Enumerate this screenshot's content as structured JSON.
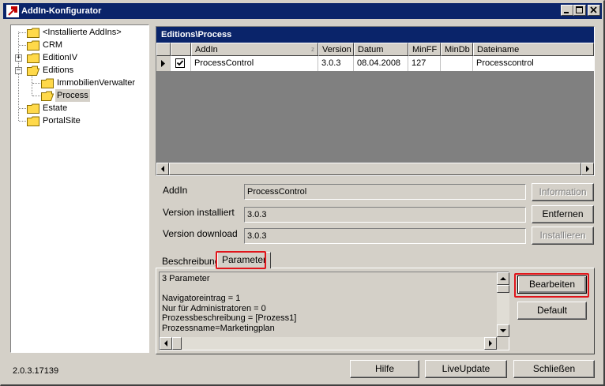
{
  "window": {
    "title": "AddIn-Konfigurator"
  },
  "tree": {
    "items": [
      {
        "label": "<Installierte AddIns>",
        "level": 0,
        "expander": ""
      },
      {
        "label": "CRM",
        "level": 0,
        "expander": ""
      },
      {
        "label": "EditionIV",
        "level": 0,
        "expander": "+"
      },
      {
        "label": "Editions",
        "level": 0,
        "expander": "−"
      },
      {
        "label": "ImmobilienVerwalter",
        "level": 1,
        "expander": ""
      },
      {
        "label": "Process",
        "level": 1,
        "expander": "",
        "selected": true
      },
      {
        "label": "Estate",
        "level": 0,
        "expander": ""
      },
      {
        "label": "PortalSite",
        "level": 0,
        "expander": ""
      }
    ]
  },
  "grid": {
    "caption": "Editions\\Process",
    "columns": [
      "AddIn",
      "Version",
      "Datum",
      "MinFF",
      "MinDb",
      "Dateiname"
    ],
    "rows": [
      {
        "checked": true,
        "addin": "ProcessControl",
        "version": "3.0.3",
        "datum": "08.04.2008",
        "minff": "127",
        "mindb": "",
        "dateiname": "Processcontrol"
      }
    ]
  },
  "details": {
    "addin_label": "AddIn",
    "addin_value": "ProcessControl",
    "version_installed_label": "Version installiert",
    "version_installed_value": "3.0.3",
    "version_download_label": "Version download",
    "version_download_value": "3.0.3",
    "information_button": "Information",
    "remove_button": "Entfernen",
    "install_button": "Installieren"
  },
  "tabs": {
    "description_tab": "Beschreibung",
    "parameter_tab": "Parameter",
    "active": "Parameter",
    "memo_text": "3 Parameter\n\nNavigatoreintrag = 1\nNur für Administratoren = 0\nProzessbeschreibung = [Prozess1]\nProzessname=Marketingplan",
    "edit_button": "Bearbeiten",
    "default_button": "Default"
  },
  "footer": {
    "version": "2.0.3.17139",
    "help_button": "Hilfe",
    "liveupdate_button": "LiveUpdate",
    "close_button": "Schließen"
  },
  "colors": {
    "highlight": "#e0141a",
    "title": "#0a246a"
  }
}
